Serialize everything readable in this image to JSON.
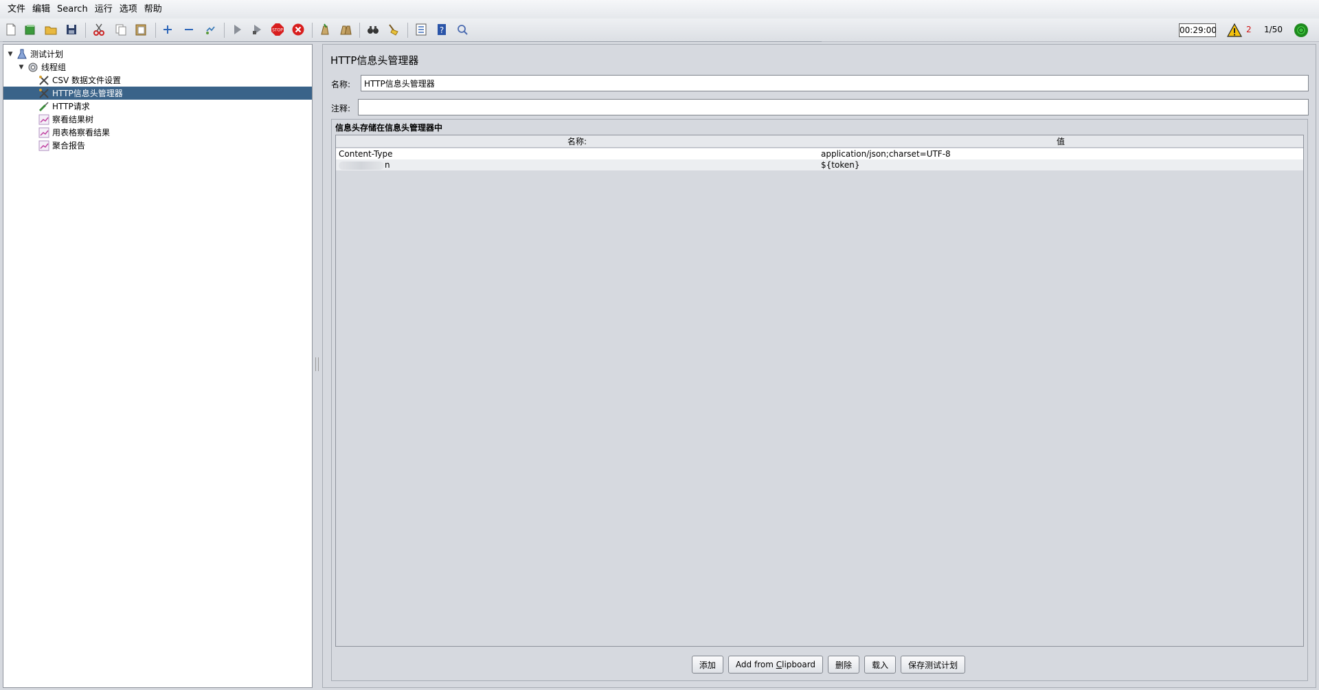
{
  "menu": {
    "items": [
      "文件",
      "编辑",
      "Search",
      "运行",
      "选项",
      "帮助"
    ]
  },
  "toolbar": {
    "icons": [
      "new-file-icon",
      "templates-icon",
      "open-icon",
      "save-icon",
      "cut-icon",
      "copy-icon",
      "paste-icon",
      "expand-icon",
      "collapse-icon",
      "toggle-icon",
      "start-icon",
      "start-no-pause-icon",
      "stop-icon",
      "shutdown-icon",
      "clear-icon",
      "clear-all-icon",
      "search-icon",
      "reset-search-icon",
      "function-helper-icon",
      "help-icon",
      "remote-icon"
    ],
    "timer": "00:29:00",
    "warning_count": "2",
    "thread_count": "1/50"
  },
  "tree": {
    "items": [
      {
        "label": "测试计划",
        "icon": "test-plan-icon",
        "level": 0,
        "toggle": "▼"
      },
      {
        "label": "线程组",
        "icon": "thread-group-icon",
        "level": 1,
        "toggle": "▼"
      },
      {
        "label": "CSV 数据文件设置",
        "icon": "config-element-icon",
        "level": 2,
        "toggle": ""
      },
      {
        "label": "HTTP信息头管理器",
        "icon": "config-element-icon",
        "level": 2,
        "toggle": "",
        "selected": true
      },
      {
        "label": "HTTP请求",
        "icon": "sampler-icon",
        "level": 2,
        "toggle": ""
      },
      {
        "label": "察看结果树",
        "icon": "listener-icon",
        "level": 2,
        "toggle": ""
      },
      {
        "label": "用表格察看结果",
        "icon": "listener-icon",
        "level": 2,
        "toggle": ""
      },
      {
        "label": "聚合报告",
        "icon": "listener-icon",
        "level": 2,
        "toggle": ""
      }
    ]
  },
  "editor": {
    "title": "HTTP信息头管理器",
    "name_label": "名称:",
    "name_value": "HTTP信息头管理器",
    "comment_label": "注释:",
    "comment_value": "",
    "section_title": "信息头存储在信息头管理器中",
    "table": {
      "headers": [
        "名称:",
        "值"
      ],
      "rows": [
        {
          "name": "Content-Type",
          "value": "application/json;charset=UTF-8",
          "masked": false
        },
        {
          "name": "n",
          "value": "${token}",
          "masked": true
        }
      ]
    },
    "buttons": {
      "add": "添加",
      "add_clipboard_prefix": "Add from ",
      "add_clipboard_mnemonic": "C",
      "add_clipboard_suffix": "lipboard",
      "delete": "删除",
      "load": "载入",
      "save": "保存测试计划"
    }
  },
  "colors": {
    "selection": "#3a6389",
    "warning": "#d01010",
    "status_ok": "#22aa22"
  }
}
